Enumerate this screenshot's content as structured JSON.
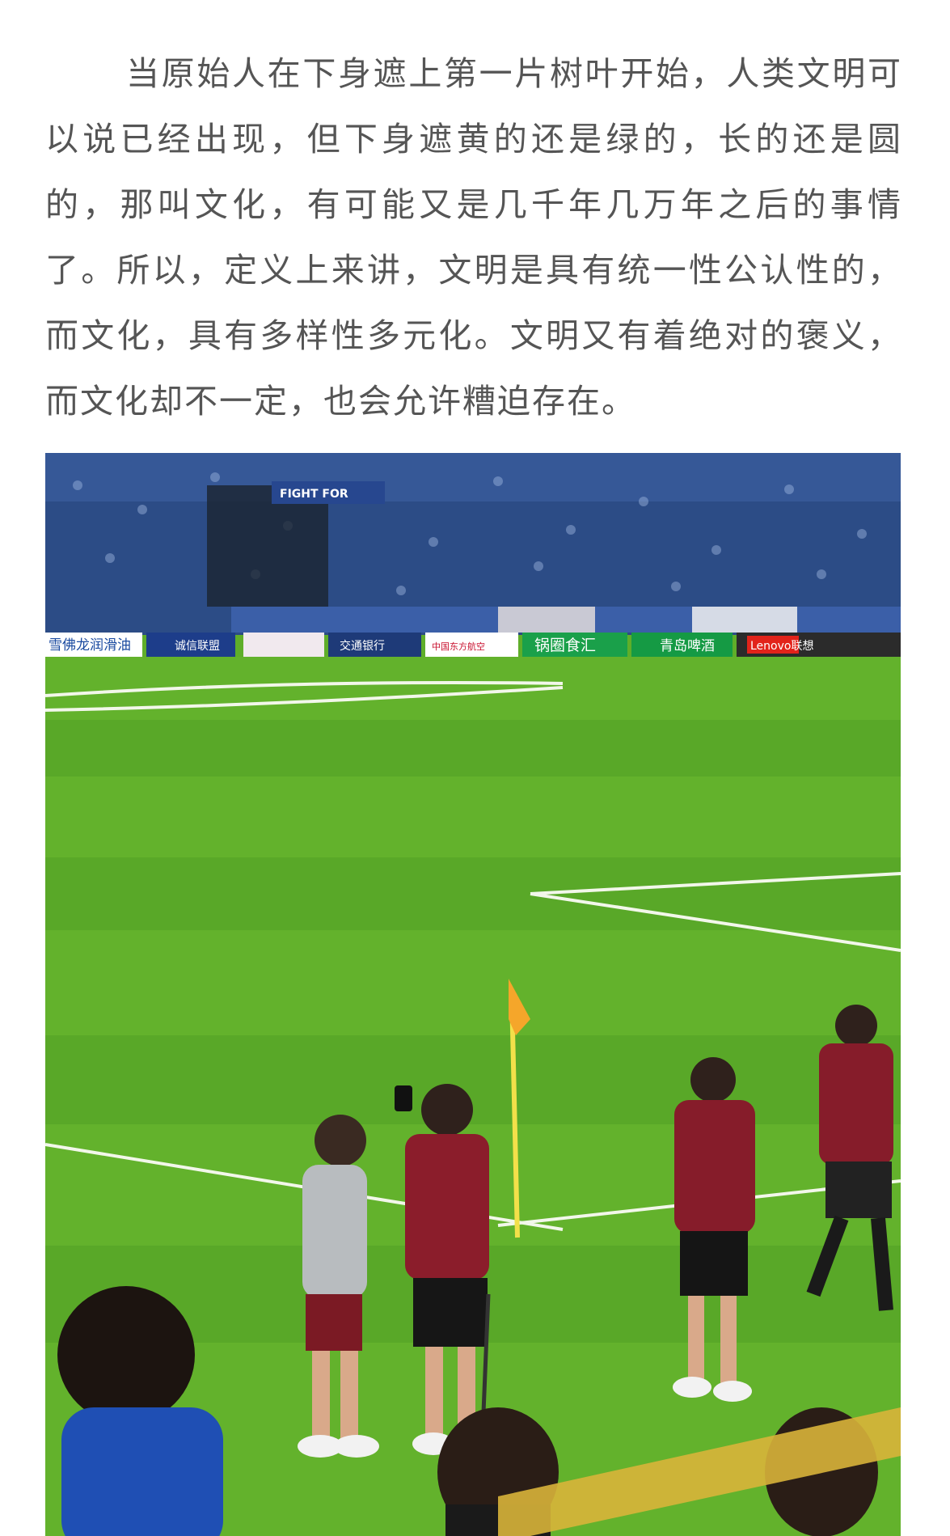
{
  "article": {
    "paragraph": "当原始人在下身遮上第一片树叶开始，人类文明可以说已经出现，但下身遮黄的还是绿的，长的还是圆的，那叫文化，有可能又是几千年几万年之后的事情了。所以，定义上来讲，文明是具有统一性公认性的，而文化，具有多样性多元化。文明又有着绝对的褒义，而文化却不一定，也会允许糟迫存在。"
  },
  "photo": {
    "ad_boards": [
      "雪佛龙润滑油",
      "诚信联盟",
      "交通银行",
      "中国东方航空",
      "锅圈食汇",
      "青岛啤酒",
      "Lenovo联想"
    ],
    "banner": "FIGHT FOR",
    "colors": {
      "grass": "#5fae2a",
      "crowd": "#2b4a8a",
      "kit": "#8a1c2a"
    }
  }
}
